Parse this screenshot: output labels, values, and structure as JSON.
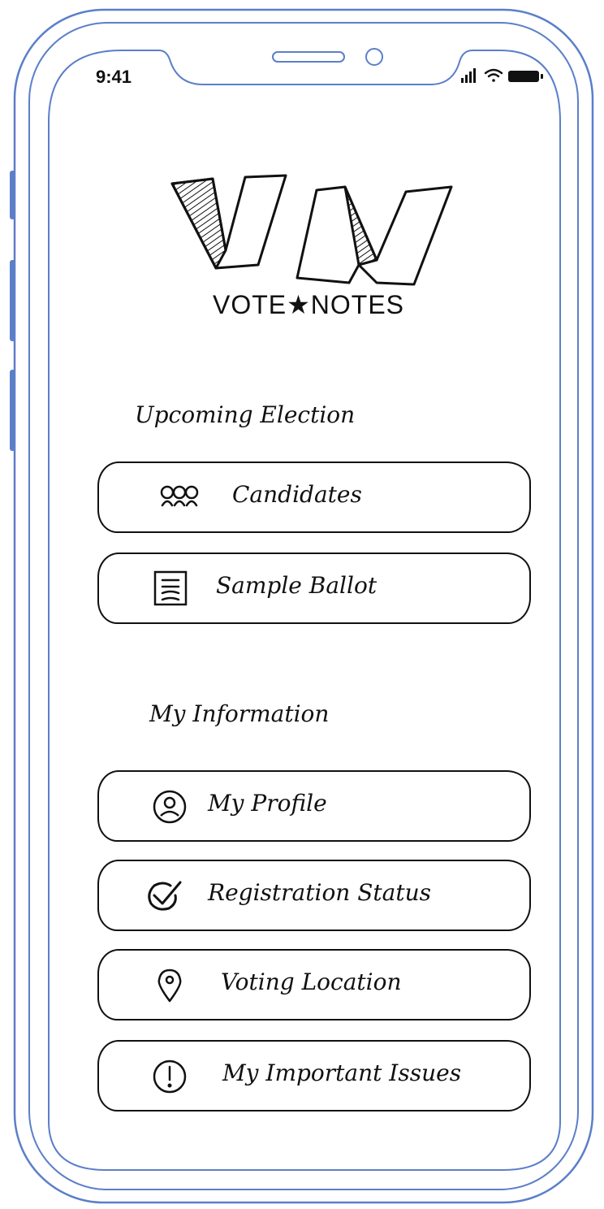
{
  "status_bar": {
    "time": "9:41",
    "icons": [
      "signal-icon",
      "wifi-icon",
      "battery-icon"
    ]
  },
  "logo": {
    "monogram": "VN",
    "caption": "VOTE★NOTES"
  },
  "sections": [
    {
      "title": "Upcoming Election",
      "items": [
        {
          "icon": "people-icon",
          "label": "Candidates"
        },
        {
          "icon": "ballot-icon",
          "label": "Sample Ballot"
        }
      ]
    },
    {
      "title": "My Information",
      "items": [
        {
          "icon": "profile-icon",
          "label": "My Profile"
        },
        {
          "icon": "checkmark-icon",
          "label": "Registration Status"
        },
        {
          "icon": "location-pin-icon",
          "label": "Voting Location"
        },
        {
          "icon": "alert-icon",
          "label": "My Important Issues"
        }
      ]
    }
  ]
}
